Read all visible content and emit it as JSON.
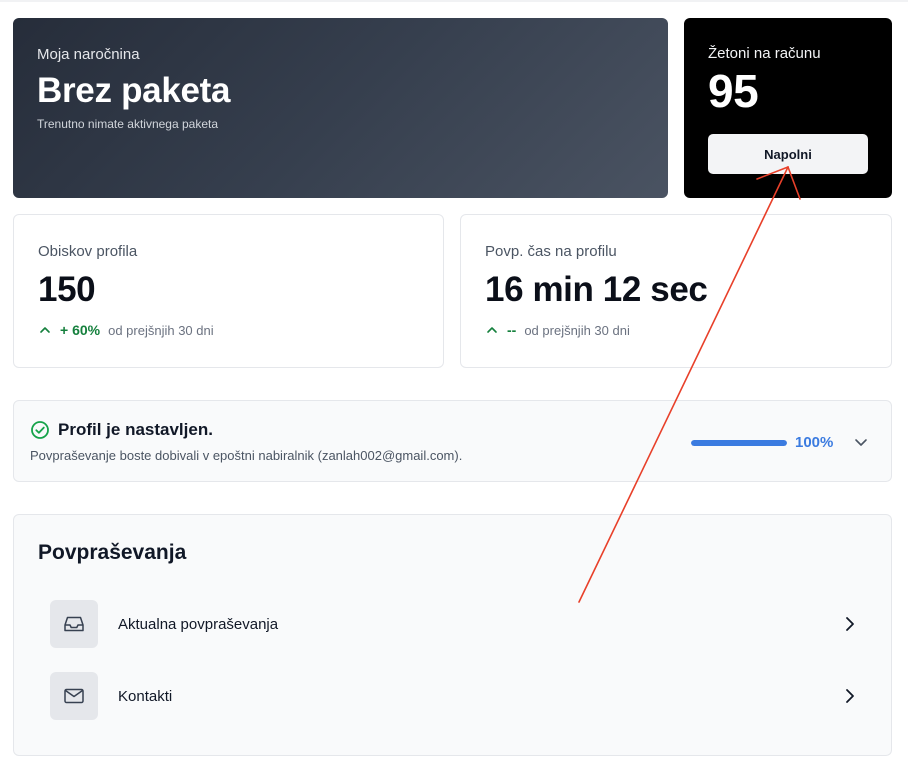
{
  "subscription": {
    "label": "Moja naročnina",
    "title": "Brez paketa",
    "description": "Trenutno nimate aktivnega paketa"
  },
  "tokens": {
    "label": "Žetoni na računu",
    "value": "95",
    "button_label": "Napolni"
  },
  "stats": [
    {
      "label": "Obiskov profila",
      "value": "150",
      "change": "+ 60%",
      "period": "od prejšnjih 30 dni"
    },
    {
      "label": "Povp. čas na profilu",
      "value": "16 min 12 sec",
      "change": "--",
      "period": "od prejšnjih 30 dni"
    }
  ],
  "profile_setup": {
    "title": "Profil je nastavljen.",
    "description": "Povpraševanje boste dobivali v epoštni nabiralnik (zanlah002@gmail.com).",
    "progress_percent": 100,
    "progress_text": "100%"
  },
  "inquiries": {
    "title": "Povpraševanja",
    "items": [
      {
        "label": "Aktualna povpraševanja",
        "icon": "inbox-icon"
      },
      {
        "label": "Kontakti",
        "icon": "mail-icon"
      }
    ]
  },
  "colors": {
    "accent_blue": "#3b7be0",
    "trend_green": "#15803d",
    "annotation_red": "#e8402a"
  }
}
